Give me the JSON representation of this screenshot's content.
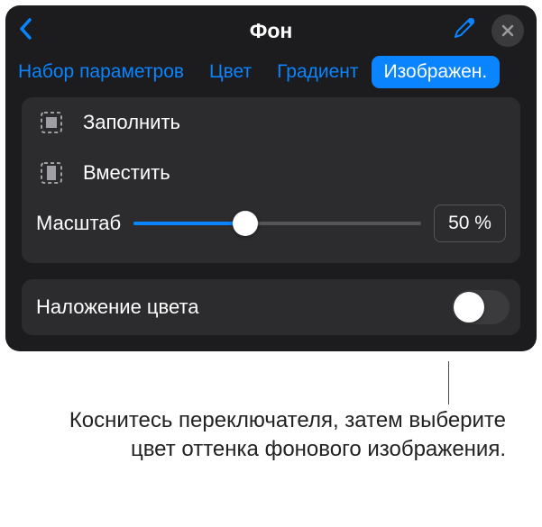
{
  "header": {
    "title": "Фон"
  },
  "tabs": {
    "preset": "Набор параметров",
    "color": "Цвет",
    "gradient": "Градиент",
    "image": "Изображен."
  },
  "options": {
    "fill": "Заполнить",
    "fit": "Вместить"
  },
  "scale": {
    "label": "Масштаб",
    "value": "50 %",
    "percent": 50
  },
  "overlay": {
    "label": "Наложение цвета",
    "enabled": false
  },
  "callout": {
    "text": "Коснитесь переключателя, затем выберите цвет оттенка фонового изображения."
  }
}
